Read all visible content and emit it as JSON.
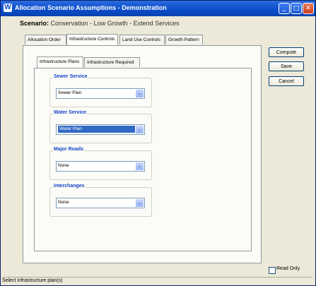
{
  "window": {
    "title": "Allocation Scenario Assumptions - Demonstration",
    "minimize_glyph": "_",
    "maximize_glyph": "□",
    "close_glyph": "✕"
  },
  "scenario": {
    "label": "Scenario:",
    "name": "Conservation - Low Growth - Extend Services"
  },
  "tabs": [
    {
      "label": "Allocation Order",
      "active": false
    },
    {
      "label": "Infrastructure Controls",
      "active": true
    },
    {
      "label": "Land Use Controls",
      "active": false
    },
    {
      "label": "Growth Pattern",
      "active": false
    }
  ],
  "subtabs": [
    {
      "label": "Infrastructure Plans",
      "active": true
    },
    {
      "label": "Infrastructure Required",
      "active": false
    }
  ],
  "groups": [
    {
      "label": "Sewer Service",
      "value": "Sewer Plan",
      "selected": false
    },
    {
      "label": "Water Service",
      "value": "Water Plan",
      "selected": true
    },
    {
      "label": "Major Roads",
      "value": "None",
      "selected": false
    },
    {
      "label": "Interchanges",
      "value": "None",
      "selected": false
    }
  ],
  "buttons": {
    "compute": "Compute",
    "save": "Save",
    "cancel": "Cancel"
  },
  "read_only": {
    "label": "Read Only",
    "checked": false
  },
  "status": "Select infrastructure plan(s)",
  "icons": {
    "app": "W",
    "dropdown": "⌄"
  },
  "colors": {
    "titlebar": "#0a4cc8",
    "group_label": "#1544c8",
    "selection": "#316ac5"
  }
}
